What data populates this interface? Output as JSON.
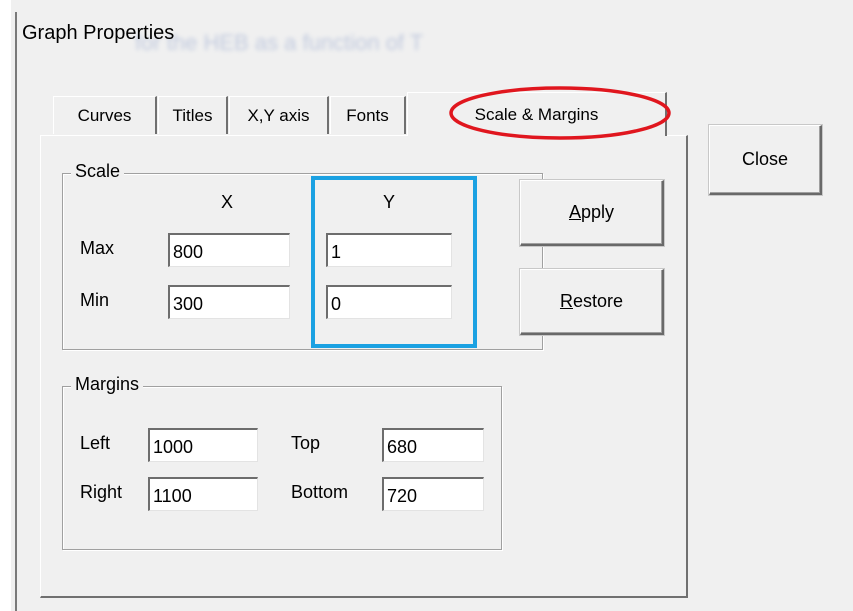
{
  "window": {
    "title": "Graph Properties",
    "background_text": "for the HEB as a function of T"
  },
  "tabs": [
    {
      "label": "Curves",
      "active": false
    },
    {
      "label": "Titles",
      "active": false
    },
    {
      "label": "X,Y axis",
      "active": false
    },
    {
      "label": "Fonts",
      "active": false
    },
    {
      "label": "Scale & Margins",
      "active": true
    }
  ],
  "buttons": {
    "close": "Close",
    "apply_mnemonic": "A",
    "apply_rest": "pply",
    "restore_mnemonic": "R",
    "restore_rest": "estore"
  },
  "scale": {
    "legend": "Scale",
    "col_x": "X",
    "col_y": "Y",
    "max_label": "Max",
    "min_label": "Min",
    "x_max": "800",
    "x_min": "300",
    "y_max": "1",
    "y_min": "0"
  },
  "margins": {
    "legend": "Margins",
    "left_label": "Left",
    "right_label": "Right",
    "top_label": "Top",
    "bottom_label": "Bottom",
    "left": "1000",
    "right": "1100",
    "top": "680",
    "bottom": "720"
  },
  "annotations": {
    "tab_ellipse_color": "#e0161e",
    "y_column_box_color": "#1ba1e2"
  },
  "colors": {
    "dialog_bg": "#f0f0f0"
  }
}
